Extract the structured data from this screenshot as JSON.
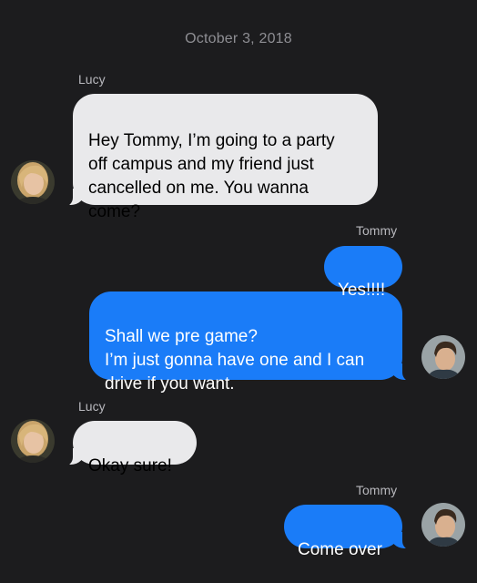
{
  "conversation": {
    "date": "October 3, 2018",
    "messages": [
      {
        "sender": "Lucy",
        "text": "Hey Tommy, I’m going to a party\noff campus and my friend just\ncancelled on me. You wanna\ncome?"
      },
      {
        "sender": "Tommy",
        "text": "Yes!!!!"
      },
      {
        "sender": "Tommy",
        "text": "Shall we pre game?\nI’m just gonna have one and I can\ndrive if you want."
      },
      {
        "sender": "Lucy",
        "text": "Okay sure!"
      },
      {
        "sender": "Tommy",
        "text": "Come over"
      }
    ],
    "sender_labels": [
      "Lucy",
      "Tommy",
      "Lucy",
      "Tommy"
    ]
  },
  "avatars": {
    "lucy": "lucy-avatar",
    "tommy": "tommy-avatar"
  },
  "colors": {
    "background": "#1c1c1e",
    "incoming_bubble": "#e9e9eb",
    "outgoing_bubble": "#1a7cf8"
  }
}
